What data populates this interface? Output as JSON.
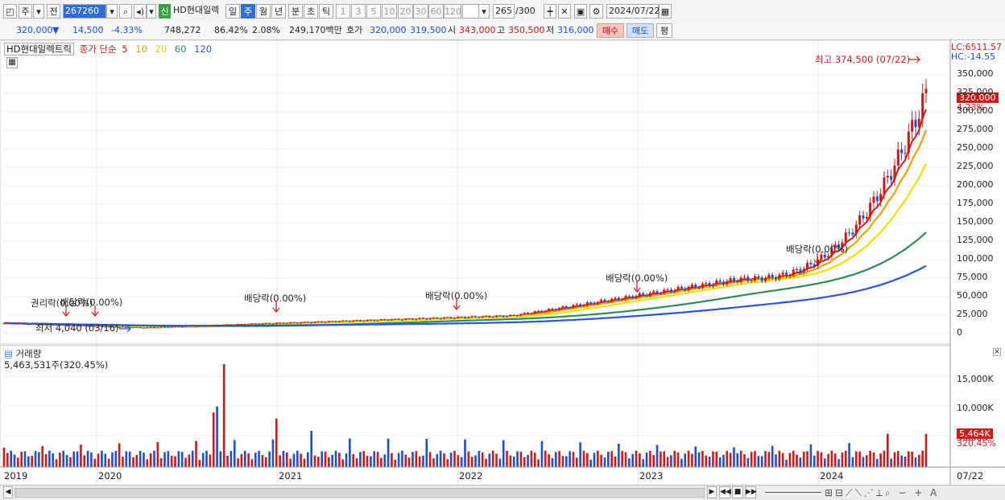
{
  "toolbar": {
    "market_mode": "주",
    "prev_label": "전",
    "code": "267260",
    "name_badge": "신",
    "name": "HD현대일렉",
    "periods": [
      "일",
      "주",
      "월",
      "년",
      "분",
      "초",
      "틱"
    ],
    "active_period": "주",
    "nums": [
      "1",
      "3",
      "5",
      "10",
      "20",
      "30",
      "60",
      "120"
    ],
    "count": "265",
    "count_total": "/300",
    "date": "2024/07/22"
  },
  "quote": {
    "price": "320,000",
    "change_arrow": "▼",
    "change": "14,500",
    "change_pct": "-4.33%",
    "volume": "748,272",
    "vol_ratio": "86.42%",
    "turnover": "2.08%",
    "amount": "249,170백만",
    "hoga_label": "호가",
    "ask": "320,000",
    "bid": "319,500",
    "open_label": "시",
    "open": "343,000",
    "high_label": "고",
    "high": "350,500",
    "low_label": "저",
    "low": "316,000",
    "buy_btn": "매수",
    "sell_btn": "매도",
    "eval_btn": "평"
  },
  "legend": {
    "title": "HD현대일렉트릭",
    "ma_label": "종가 단순",
    "ma_periods": [
      "5",
      "10",
      "20",
      "60",
      "120"
    ],
    "ma_colors": [
      "#d01818",
      "#f0a000",
      "#f0e000",
      "#2e8b57",
      "#2a55d8"
    ]
  },
  "price_panel": {
    "lc": "LC:6511.57",
    "hc": "HC:-14.55",
    "last_price_tag": "320,000",
    "last_pct_tag": "4.23%",
    "high_note": "최고 374,500 (07/22)",
    "low_note": "최저 4,040 (03/16)",
    "events": [
      "권리락(0.00%)",
      "배당락(0.00%)",
      "배당락(0.00%)",
      "배당락(0.00%)",
      "배당락(0.00%)",
      "배당락(0.00%)"
    ],
    "y_ticks": [
      "350,000",
      "325,000",
      "300,000",
      "275,000",
      "250,000",
      "225,000",
      "200,000",
      "175,000",
      "150,000",
      "125,000",
      "100,000",
      "75,000",
      "50,000",
      "25,000",
      "0"
    ]
  },
  "volume_panel": {
    "title": "거래량",
    "value": "5,463,531주(320.45%)",
    "y_ticks": [
      "15,000K",
      "10,000K",
      "5,000K"
    ],
    "last_vol_tag": "5,464K",
    "last_vol_pct": "320.45%"
  },
  "x_axis": {
    "years": [
      "2019",
      "2020",
      "2021",
      "2022",
      "2023",
      "2024"
    ],
    "last_date": "07/22"
  },
  "colors": {
    "up": "#d01818",
    "down": "#1a4fd6",
    "accent": "#2f6fd1"
  }
}
